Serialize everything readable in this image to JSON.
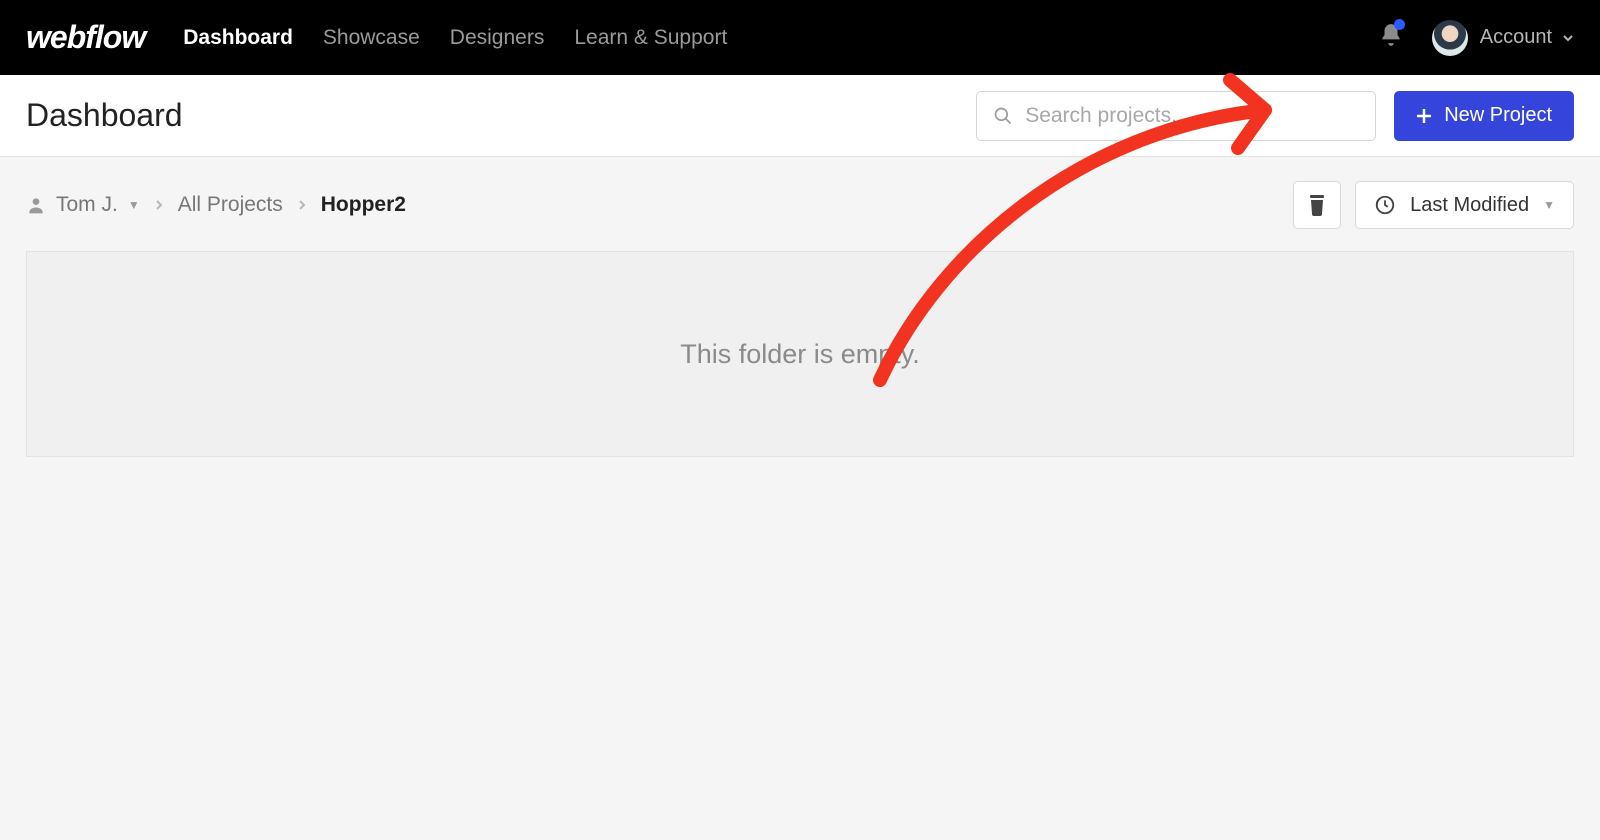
{
  "brand": "webflow",
  "nav": {
    "dashboard": "Dashboard",
    "showcase": "Showcase",
    "designers": "Designers",
    "learn": "Learn & Support"
  },
  "account_label": "Account",
  "page_title": "Dashboard",
  "search": {
    "placeholder": "Search projects..."
  },
  "new_project_label": "New Project",
  "breadcrumb": {
    "user": "Tom J.",
    "root": "All Projects",
    "current": "Hopper2"
  },
  "sort_label": "Last Modified",
  "empty_message": "This folder is empty."
}
